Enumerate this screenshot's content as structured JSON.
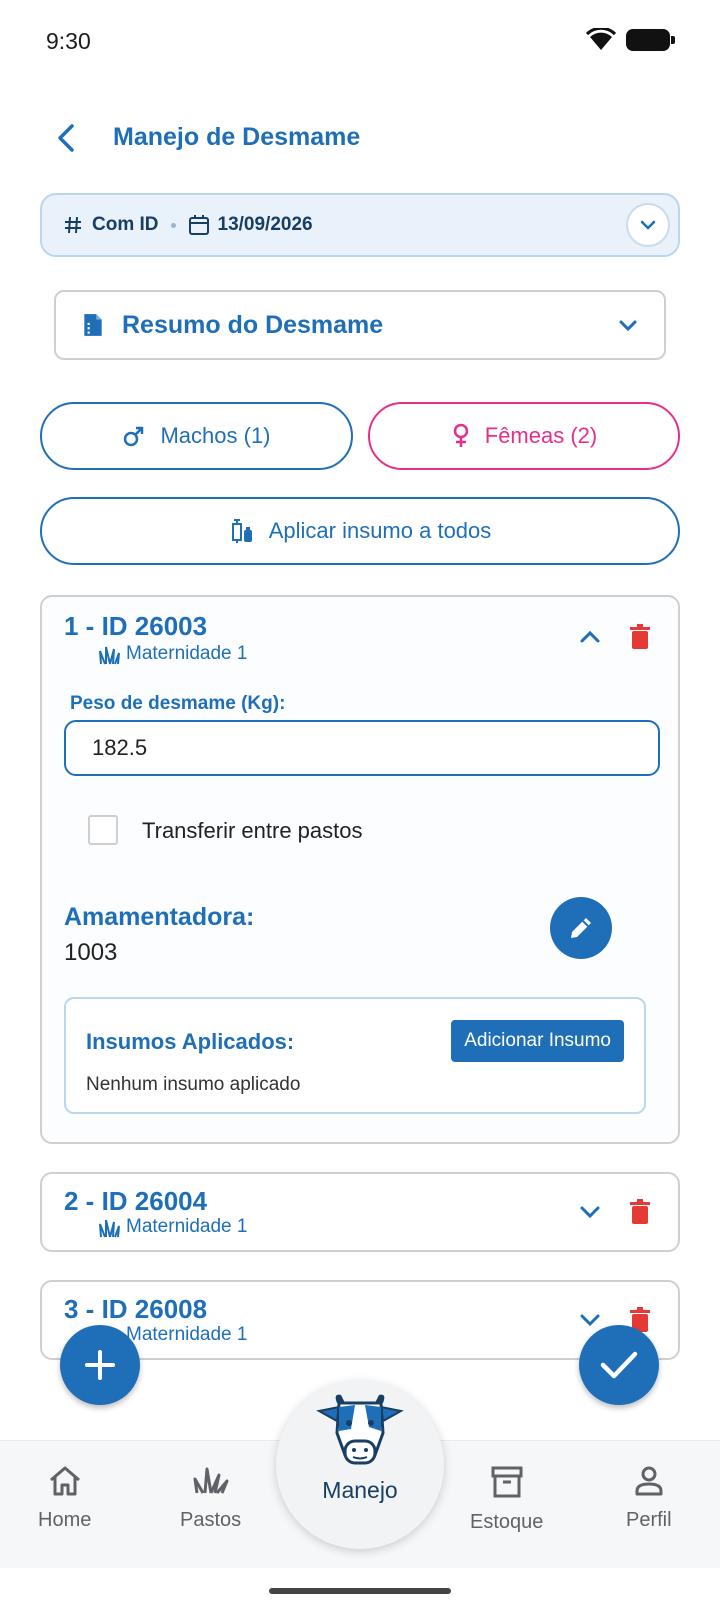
{
  "status_bar": {
    "time": "9:30"
  },
  "header": {
    "title": "Manejo de Desmame"
  },
  "filter": {
    "mode": "Com ID",
    "date": "13/09/2026"
  },
  "summary": {
    "label": "Resumo do Desmame"
  },
  "gender_buttons": {
    "male": "Machos (1)",
    "female": "Fêmeas (2)"
  },
  "apply_all": {
    "label": "Aplicar insumo a todos"
  },
  "animals": [
    {
      "title": "1 - ID 26003",
      "pasture": "Maternidade 1",
      "weight_label": "Peso de desmame (Kg):",
      "weight_value": "182.5",
      "transfer_label": "Transferir entre pastos",
      "nurse_label": "Amamentadora:",
      "nurse_value": "1003",
      "inputs_title": "Insumos Aplicados:",
      "add_input_label": "Adicionar Insumo",
      "inputs_empty": "Nenhum insumo aplicado"
    },
    {
      "title": "2 - ID 26004",
      "pasture": "Maternidade 1"
    },
    {
      "title": "3 - ID 26008",
      "pasture": "Maternidade 1"
    }
  ],
  "bottom_nav": {
    "home": "Home",
    "pastos": "Pastos",
    "manejo": "Manejo",
    "estoque": "Estoque",
    "perfil": "Perfil"
  },
  "colors": {
    "primary": "#1f6fb8",
    "female": "#e52f8a",
    "delete": "#e53935",
    "filter_bg": "#e9f2fb"
  },
  "icons": [
    "back-arrow-icon",
    "hash-icon",
    "calendar-icon",
    "chevron-down-icon",
    "document-icon",
    "male-icon",
    "female-icon",
    "syringe-icon",
    "grass-icon",
    "chevron-up-icon",
    "trash-icon",
    "pencil-icon",
    "plus-icon",
    "check-icon",
    "home-icon",
    "pastos-icon",
    "cow-icon",
    "archive-icon",
    "person-icon"
  ]
}
